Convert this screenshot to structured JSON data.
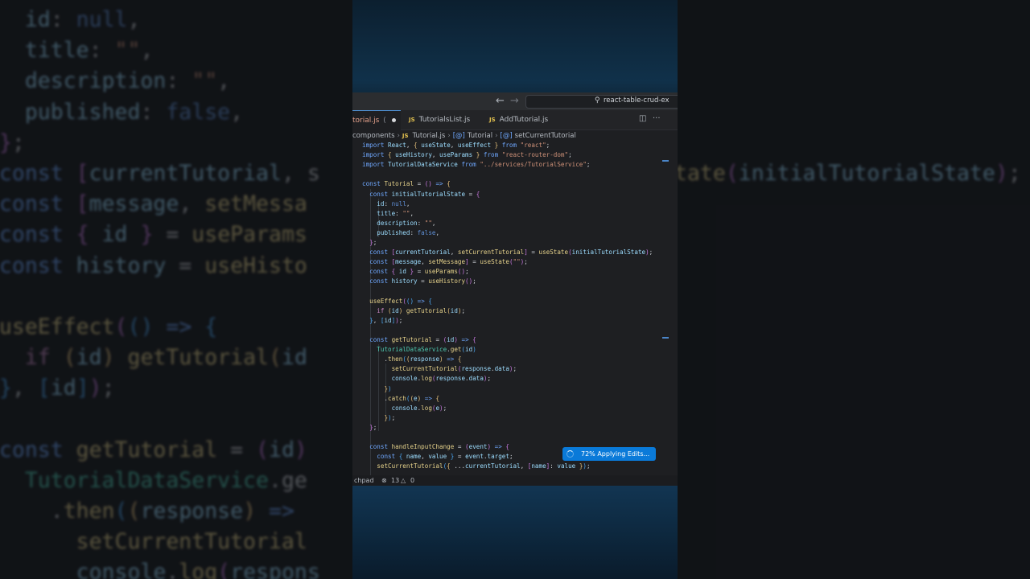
{
  "window": {
    "search_label": "react-table-crud-ex",
    "back_icon": "arrow-left-icon",
    "forward_icon": "arrow-right-icon",
    "search_icon": "search-icon"
  },
  "tabs": [
    {
      "label": "torial.js",
      "dirty_marker": "(",
      "active": true
    },
    {
      "badge": "JS",
      "label": "TutorialsList.js",
      "active": false
    },
    {
      "badge": "JS",
      "label": "AddTutorial.js",
      "active": false
    }
  ],
  "tab_actions": {
    "split_icon": "split-editor-icon",
    "more_icon": "more-actions-icon"
  },
  "breadcrumb": {
    "folder": "components",
    "file_badge": "JS",
    "file": "Tutorial.js",
    "symbol_badge": "[@]",
    "symbol": "Tutorial",
    "sub_badge": "[@]",
    "sub_symbol": "setCurrentTutorial"
  },
  "status_bar": {
    "left_label": "chpad",
    "errors_icon": "error-icon",
    "errors": "13",
    "warnings_icon": "warning-icon",
    "warnings": "0"
  },
  "progress": {
    "label": "72% Applying Edits...",
    "percent": 72
  },
  "code_lines": [
    [
      [
        "kw",
        "import "
      ],
      [
        "var",
        "React"
      ],
      [
        "pun",
        ", "
      ],
      [
        "br1",
        "{ "
      ],
      [
        "var",
        "useState"
      ],
      [
        "pun",
        ", "
      ],
      [
        "var",
        "useEffect "
      ],
      [
        "br1",
        "}"
      ],
      [
        "kw",
        " from "
      ],
      [
        "str",
        "\"react\""
      ],
      [
        "pun",
        ";"
      ]
    ],
    [
      [
        "kw",
        "import "
      ],
      [
        "br1",
        "{ "
      ],
      [
        "var",
        "useHistory"
      ],
      [
        "pun",
        ", "
      ],
      [
        "var",
        "useParams "
      ],
      [
        "br1",
        "}"
      ],
      [
        "kw",
        " from "
      ],
      [
        "str",
        "\"react-router-dom\""
      ],
      [
        "pun",
        ";"
      ]
    ],
    [
      [
        "kw",
        "import "
      ],
      [
        "var",
        "TutorialDataService"
      ],
      [
        "kw",
        " from "
      ],
      [
        "str",
        "\"../services/TutorialService\""
      ],
      [
        "pun",
        ";"
      ]
    ],
    [],
    [
      [
        "kw",
        "const "
      ],
      [
        "fn",
        "Tutorial"
      ],
      [
        "pun",
        " = "
      ],
      [
        "br2",
        "()"
      ],
      [
        "kw",
        " => "
      ],
      [
        "br1",
        "{"
      ]
    ],
    [
      [
        "pun",
        "  "
      ],
      [
        "kw",
        "const "
      ],
      [
        "var",
        "initialTutorialState"
      ],
      [
        "pun",
        " = "
      ],
      [
        "br2",
        "{"
      ]
    ],
    [
      [
        "pun",
        "    "
      ],
      [
        "var",
        "id"
      ],
      [
        "pun",
        ": "
      ],
      [
        "lit",
        "null"
      ],
      [
        "pun",
        ","
      ]
    ],
    [
      [
        "pun",
        "    "
      ],
      [
        "var",
        "title"
      ],
      [
        "pun",
        ": "
      ],
      [
        "str",
        "\"\""
      ],
      [
        "pun",
        ","
      ]
    ],
    [
      [
        "pun",
        "    "
      ],
      [
        "var",
        "description"
      ],
      [
        "pun",
        ": "
      ],
      [
        "str",
        "\"\""
      ],
      [
        "pun",
        ","
      ]
    ],
    [
      [
        "pun",
        "    "
      ],
      [
        "var",
        "published"
      ],
      [
        "pun",
        ": "
      ],
      [
        "lit",
        "false"
      ],
      [
        "pun",
        ","
      ]
    ],
    [
      [
        "pun",
        "  "
      ],
      [
        "br2",
        "}"
      ],
      [
        "pun",
        ";"
      ]
    ],
    [
      [
        "pun",
        "  "
      ],
      [
        "kw",
        "const "
      ],
      [
        "br2",
        "["
      ],
      [
        "var",
        "currentTutorial"
      ],
      [
        "pun",
        ", "
      ],
      [
        "fn",
        "setCurrentTutorial"
      ],
      [
        "br2",
        "]"
      ],
      [
        "pun",
        " = "
      ],
      [
        "fn",
        "useState"
      ],
      [
        "br2",
        "("
      ],
      [
        "var",
        "initialTutorialState"
      ],
      [
        "br2",
        ")"
      ],
      [
        "pun",
        ";"
      ]
    ],
    [
      [
        "pun",
        "  "
      ],
      [
        "kw",
        "const "
      ],
      [
        "br2",
        "["
      ],
      [
        "var",
        "message"
      ],
      [
        "pun",
        ", "
      ],
      [
        "fn",
        "setMessage"
      ],
      [
        "br2",
        "]"
      ],
      [
        "pun",
        " = "
      ],
      [
        "fn",
        "useState"
      ],
      [
        "br2",
        "("
      ],
      [
        "str",
        "\"\""
      ],
      [
        "br2",
        ")"
      ],
      [
        "pun",
        ";"
      ]
    ],
    [
      [
        "pun",
        "  "
      ],
      [
        "kw",
        "const "
      ],
      [
        "br2",
        "{ "
      ],
      [
        "var",
        "id "
      ],
      [
        "br2",
        "}"
      ],
      [
        "pun",
        " = "
      ],
      [
        "fn",
        "useParams"
      ],
      [
        "br2",
        "()"
      ],
      [
        "pun",
        ";"
      ]
    ],
    [
      [
        "pun",
        "  "
      ],
      [
        "kw",
        "const "
      ],
      [
        "var",
        "history"
      ],
      [
        "pun",
        " = "
      ],
      [
        "fn",
        "useHistory"
      ],
      [
        "br2",
        "()"
      ],
      [
        "pun",
        ";"
      ]
    ],
    [],
    [
      [
        "pun",
        "  "
      ],
      [
        "fn",
        "useEffect"
      ],
      [
        "br2",
        "("
      ],
      [
        "br3",
        "()"
      ],
      [
        "kw",
        " => "
      ],
      [
        "br3",
        "{"
      ]
    ],
    [
      [
        "pun",
        "    "
      ],
      [
        "ctl",
        "if "
      ],
      [
        "br1",
        "("
      ],
      [
        "var",
        "id"
      ],
      [
        "br1",
        ")"
      ],
      [
        "fn",
        " getTutorial"
      ],
      [
        "br1",
        "("
      ],
      [
        "var",
        "id"
      ],
      [
        "br1",
        ")"
      ],
      [
        "pun",
        ";"
      ]
    ],
    [
      [
        "pun",
        "  "
      ],
      [
        "br3",
        "}"
      ],
      [
        "pun",
        ", "
      ],
      [
        "br3",
        "["
      ],
      [
        "var",
        "id"
      ],
      [
        "br3",
        "]"
      ],
      [
        "br2",
        ")"
      ],
      [
        "pun",
        ";"
      ]
    ],
    [],
    [
      [
        "pun",
        "  "
      ],
      [
        "kw",
        "const "
      ],
      [
        "fn",
        "getTutorial"
      ],
      [
        "pun",
        " = "
      ],
      [
        "br2",
        "("
      ],
      [
        "var",
        "id"
      ],
      [
        "br2",
        ")"
      ],
      [
        "kw",
        " => "
      ],
      [
        "br2",
        "{"
      ]
    ],
    [
      [
        "pun",
        "    "
      ],
      [
        "cls",
        "TutorialDataService"
      ],
      [
        "pun",
        "."
      ],
      [
        "fn",
        "get"
      ],
      [
        "br3",
        "("
      ],
      [
        "var",
        "id"
      ],
      [
        "br3",
        ")"
      ]
    ],
    [
      [
        "pun",
        "      ."
      ],
      [
        "fn",
        "then"
      ],
      [
        "br3",
        "("
      ],
      [
        "br1",
        "("
      ],
      [
        "var",
        "response"
      ],
      [
        "br1",
        ")"
      ],
      [
        "kw",
        " => "
      ],
      [
        "br1",
        "{"
      ]
    ],
    [
      [
        "pun",
        "        "
      ],
      [
        "fn",
        "setCurrentTutorial"
      ],
      [
        "br2",
        "("
      ],
      [
        "var",
        "response"
      ],
      [
        "pun",
        "."
      ],
      [
        "var",
        "data"
      ],
      [
        "br2",
        ")"
      ],
      [
        "pun",
        ";"
      ]
    ],
    [
      [
        "pun",
        "        "
      ],
      [
        "var",
        "console"
      ],
      [
        "pun",
        "."
      ],
      [
        "fn",
        "log"
      ],
      [
        "br2",
        "("
      ],
      [
        "var",
        "response"
      ],
      [
        "pun",
        "."
      ],
      [
        "var",
        "data"
      ],
      [
        "br2",
        ")"
      ],
      [
        "pun",
        ";"
      ]
    ],
    [
      [
        "pun",
        "      "
      ],
      [
        "br1",
        "}"
      ],
      [
        "br3",
        ")"
      ]
    ],
    [
      [
        "pun",
        "      ."
      ],
      [
        "fn",
        "catch"
      ],
      [
        "br3",
        "("
      ],
      [
        "br1",
        "("
      ],
      [
        "var",
        "e"
      ],
      [
        "br1",
        ")"
      ],
      [
        "kw",
        " => "
      ],
      [
        "br1",
        "{"
      ]
    ],
    [
      [
        "pun",
        "        "
      ],
      [
        "var",
        "console"
      ],
      [
        "pun",
        "."
      ],
      [
        "fn",
        "log"
      ],
      [
        "br2",
        "("
      ],
      [
        "var",
        "e"
      ],
      [
        "br2",
        ")"
      ],
      [
        "pun",
        ";"
      ]
    ],
    [
      [
        "pun",
        "      "
      ],
      [
        "br1",
        "}"
      ],
      [
        "br3",
        ")"
      ],
      [
        "pun",
        ";"
      ]
    ],
    [
      [
        "pun",
        "  "
      ],
      [
        "br2",
        "}"
      ],
      [
        "pun",
        ";"
      ]
    ],
    [],
    [
      [
        "pun",
        "  "
      ],
      [
        "kw",
        "const "
      ],
      [
        "fn",
        "handleInputChange"
      ],
      [
        "pun",
        " = "
      ],
      [
        "br2",
        "("
      ],
      [
        "var",
        "event"
      ],
      [
        "br2",
        ")"
      ],
      [
        "kw",
        " => "
      ],
      [
        "br2",
        "{"
      ]
    ],
    [
      [
        "pun",
        "    "
      ],
      [
        "kw",
        "const "
      ],
      [
        "br3",
        "{ "
      ],
      [
        "var",
        "name"
      ],
      [
        "pun",
        ", "
      ],
      [
        "var",
        "value "
      ],
      [
        "br3",
        "}"
      ],
      [
        "pun",
        " = "
      ],
      [
        "var",
        "event"
      ],
      [
        "pun",
        "."
      ],
      [
        "var",
        "target"
      ],
      [
        "pun",
        ";"
      ]
    ],
    [
      [
        "pun",
        "    "
      ],
      [
        "fn",
        "setCurrentTutorial"
      ],
      [
        "br3",
        "("
      ],
      [
        "br1",
        "{ "
      ],
      [
        "pun",
        "..."
      ],
      [
        "var",
        "currentTutorial"
      ],
      [
        "pun",
        ", "
      ],
      [
        "br2",
        "["
      ],
      [
        "var",
        "name"
      ],
      [
        "br2",
        "]"
      ],
      [
        "pun",
        ": "
      ],
      [
        "var",
        "value "
      ],
      [
        "br1",
        "}"
      ],
      [
        "br3",
        ")"
      ],
      [
        "pun",
        ";"
      ]
    ]
  ],
  "bg_left_lines": [
    [
      [
        "pun",
        "    "
      ],
      [
        "var",
        "id"
      ],
      [
        "pun",
        ": "
      ],
      [
        "lit",
        "null"
      ],
      [
        "pun",
        ","
      ]
    ],
    [
      [
        "pun",
        "    "
      ],
      [
        "var",
        "title"
      ],
      [
        "pun",
        ": "
      ],
      [
        "str",
        "\"\""
      ],
      [
        "pun",
        ","
      ]
    ],
    [
      [
        "pun",
        "    "
      ],
      [
        "var",
        "description"
      ],
      [
        "pun",
        ": "
      ],
      [
        "str",
        "\"\""
      ],
      [
        "pun",
        ","
      ]
    ],
    [
      [
        "pun",
        "    "
      ],
      [
        "var",
        "published"
      ],
      [
        "pun",
        ": "
      ],
      [
        "lit",
        "false"
      ],
      [
        "pun",
        ","
      ]
    ],
    [
      [
        "pun",
        "  "
      ],
      [
        "br2",
        "}"
      ],
      [
        "pun",
        ";"
      ]
    ],
    [
      [
        "pun",
        "  "
      ],
      [
        "kw",
        "const "
      ],
      [
        "br2",
        "["
      ],
      [
        "var",
        "currentTutorial"
      ],
      [
        "pun",
        ", s"
      ]
    ],
    [
      [
        "pun",
        "  "
      ],
      [
        "kw",
        "const "
      ],
      [
        "br2",
        "["
      ],
      [
        "var",
        "message"
      ],
      [
        "pun",
        ", "
      ],
      [
        "fn",
        "setMessa"
      ]
    ],
    [
      [
        "pun",
        "  "
      ],
      [
        "kw",
        "const "
      ],
      [
        "br2",
        "{ "
      ],
      [
        "var",
        "id "
      ],
      [
        "br2",
        "}"
      ],
      [
        "pun",
        " = "
      ],
      [
        "fn",
        "useParams"
      ]
    ],
    [
      [
        "pun",
        "  "
      ],
      [
        "kw",
        "const "
      ],
      [
        "var",
        "history"
      ],
      [
        "pun",
        " = "
      ],
      [
        "fn",
        "useHisto"
      ]
    ],
    [],
    [
      [
        "pun",
        "  "
      ],
      [
        "fn",
        "useEffect"
      ],
      [
        "br2",
        "("
      ],
      [
        "br3",
        "()"
      ],
      [
        "kw",
        " => "
      ],
      [
        "br3",
        "{"
      ]
    ],
    [
      [
        "pun",
        "    "
      ],
      [
        "ctl",
        "if "
      ],
      [
        "br1",
        "("
      ],
      [
        "var",
        "id"
      ],
      [
        "br1",
        ")"
      ],
      [
        "fn",
        " getTutorial"
      ],
      [
        "br1",
        "("
      ],
      [
        "var",
        "id"
      ]
    ],
    [
      [
        "pun",
        "  "
      ],
      [
        "br3",
        "}"
      ],
      [
        "pun",
        ", "
      ],
      [
        "br3",
        "["
      ],
      [
        "var",
        "id"
      ],
      [
        "br3",
        "]"
      ],
      [
        "br2",
        ")"
      ],
      [
        "pun",
        ";"
      ]
    ],
    [],
    [
      [
        "pun",
        "  "
      ],
      [
        "kw",
        "const "
      ],
      [
        "fn",
        "getTutorial"
      ],
      [
        "pun",
        " = "
      ],
      [
        "br2",
        "("
      ],
      [
        "var",
        "id"
      ],
      [
        "br2",
        ")"
      ]
    ],
    [
      [
        "pun",
        "    "
      ],
      [
        "cls",
        "TutorialDataService"
      ],
      [
        "pun",
        ".ge"
      ]
    ],
    [
      [
        "pun",
        "      ."
      ],
      [
        "fn",
        "then"
      ],
      [
        "br3",
        "("
      ],
      [
        "br1",
        "("
      ],
      [
        "var",
        "response"
      ],
      [
        "br1",
        ")"
      ],
      [
        "kw",
        " => "
      ]
    ],
    [
      [
        "pun",
        "        "
      ],
      [
        "fn",
        "setCurrentTutorial"
      ]
    ],
    [
      [
        "pun",
        "        "
      ],
      [
        "var",
        "console"
      ],
      [
        "pun",
        "."
      ],
      [
        "fn",
        "log"
      ],
      [
        "br2",
        "("
      ],
      [
        "var",
        "respons"
      ]
    ]
  ],
  "bg_right_lines": [
    [],
    [],
    [],
    [],
    [],
    [
      [
        "fn",
        "tate"
      ],
      [
        "br2",
        "("
      ],
      [
        "var",
        "initialTutorialState"
      ],
      [
        "br2",
        ")"
      ],
      [
        "pun",
        ";"
      ]
    ]
  ]
}
